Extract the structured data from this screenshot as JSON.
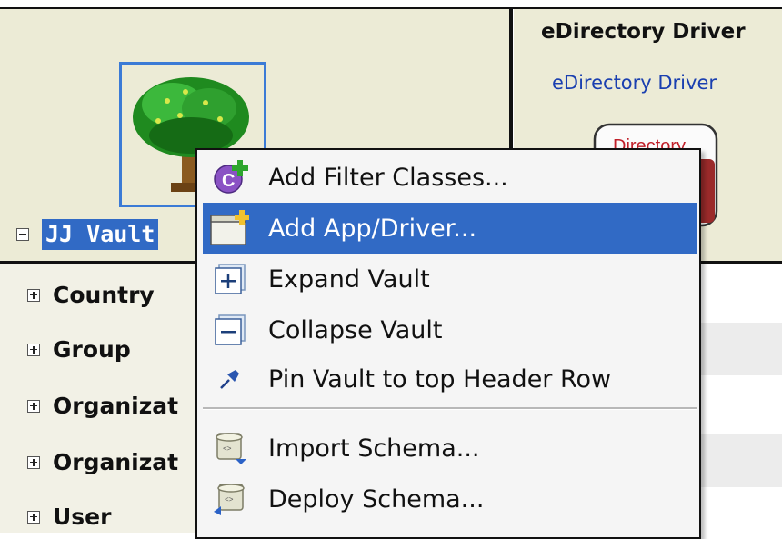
{
  "vault": {
    "label": "JJ Vault",
    "toggle": "expanded"
  },
  "driver": {
    "header_title": "eDirectory Driver",
    "link_text": "eDirectory Driver",
    "icon_label": "Directory"
  },
  "sidebar": {
    "items": [
      {
        "label": "Country"
      },
      {
        "label": "Group"
      },
      {
        "label": "Organizat"
      },
      {
        "label": "Organizat"
      },
      {
        "label": "User"
      }
    ]
  },
  "context_menu": {
    "items": [
      {
        "label": "Add Filter Classes...",
        "icon": "add-filter-class-icon",
        "highlighted": false
      },
      {
        "label": "Add App/Driver...",
        "icon": "add-driver-icon",
        "highlighted": true
      },
      {
        "label": "Expand Vault",
        "icon": "expand-icon",
        "highlighted": false
      },
      {
        "label": "Collapse Vault",
        "icon": "collapse-icon",
        "highlighted": false
      },
      {
        "label": "Pin Vault to top Header Row",
        "icon": "pin-icon",
        "highlighted": false
      },
      {
        "label": "Import Schema...",
        "icon": "import-schema-icon",
        "highlighted": false
      },
      {
        "label": "Deploy Schema...",
        "icon": "deploy-schema-icon",
        "highlighted": false
      }
    ]
  },
  "colors": {
    "header_bg": "#ecebd6",
    "selection": "#316ac5",
    "link": "#1a3fb0",
    "menu_bg": "#f5f5f5"
  }
}
